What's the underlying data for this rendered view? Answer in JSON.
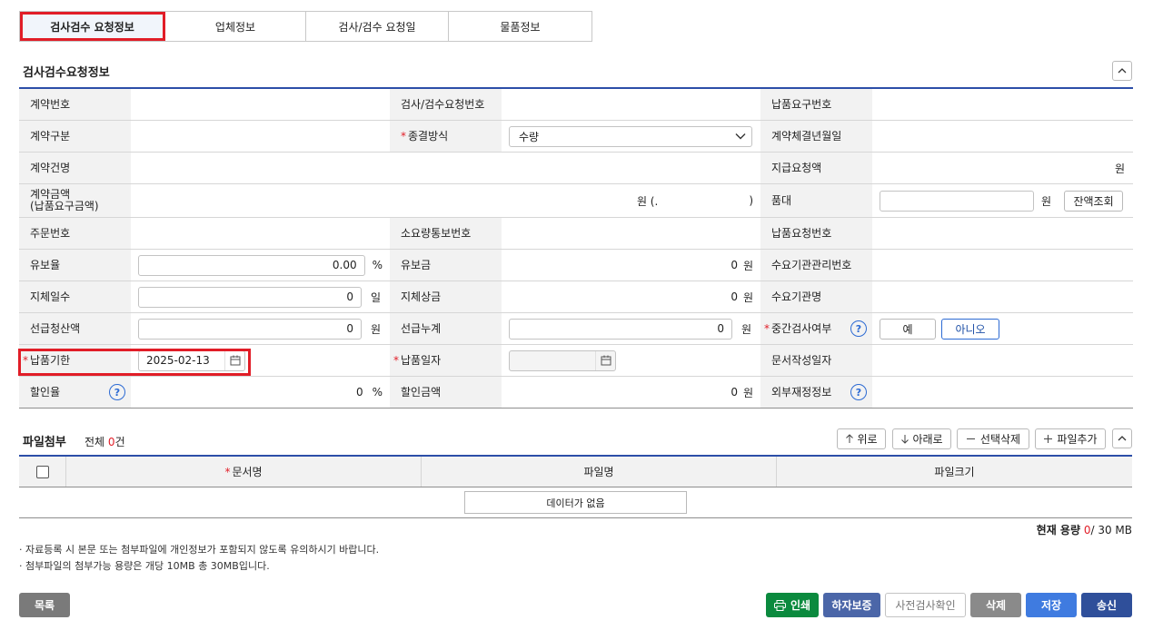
{
  "tabs": [
    "검사검수 요청정보",
    "업체정보",
    "검사/검수 요청일",
    "물품정보"
  ],
  "section_title": "검사검수요청정보",
  "fields": {
    "contract_no": "계약번호",
    "inspect_req_no": "검사/검수요청번호",
    "delivery_req_no": "납품요구번호",
    "contract_type": "계약구분",
    "close_method": "종결방식",
    "close_method_value": "수량",
    "contract_date": "계약체결년월일",
    "contract_name": "계약건명",
    "pay_req_amount": "지급요청액",
    "pay_req_unit": "원",
    "contract_amount_l1": "계약금액",
    "contract_amount_l2": "(납품요구금액)",
    "contract_amount_unit": "원 (.",
    "contract_amount_close": ")",
    "price": "품대",
    "price_unit": "원",
    "balance_btn": "잔액조회",
    "order_no": "주문번호",
    "req_notice_no": "소요량통보번호",
    "delivery_request_no": "납품요청번호",
    "retention_rate": "유보율",
    "retention_rate_value": "0.00",
    "retention_rate_unit": "%",
    "retention_amount": "유보금",
    "retention_amount_value": "0",
    "retention_amount_unit": "원",
    "agency_mgmt_no": "수요기관관리번호",
    "delay_days": "지체일수",
    "delay_days_value": "0",
    "delay_days_unit": "일",
    "delay_penalty": "지체상금",
    "delay_penalty_value": "0",
    "delay_penalty_unit": "원",
    "agency_name": "수요기관명",
    "advance_settle": "선급청산액",
    "advance_settle_value": "0",
    "advance_settle_unit": "원",
    "advance_total": "선급누계",
    "advance_total_value": "0",
    "advance_total_unit": "원",
    "mid_inspect": "중간검사여부",
    "yes": "예",
    "no": "아니오",
    "delivery_deadline": "납품기한",
    "delivery_deadline_value": "2025-02-13",
    "delivery_date": "납품일자",
    "doc_date": "문서작성일자",
    "discount_rate": "할인율",
    "discount_rate_value": "0",
    "discount_rate_unit": "%",
    "discount_amount": "할인금액",
    "discount_amount_value": "0",
    "discount_amount_unit": "원",
    "external_finance": "외부재정정보"
  },
  "attachments": {
    "title": "파일첨부",
    "count_label": "전체",
    "count": "0",
    "count_unit": "건",
    "buttons": {
      "up": "위로",
      "down": "아래로",
      "delete": "선택삭제",
      "add": "파일추가"
    },
    "columns": [
      "문서명",
      "파일명",
      "파일크기"
    ],
    "empty": "데이터가 없음",
    "usage_label": "현재 용량",
    "usage_value": "0",
    "usage_total": "/ 30 MB",
    "notices": [
      "자료등록 시 본문 또는 첨부파일에 개인정보가 포함되지 않도록 유의하시기 바랍니다.",
      "첨부파일의 첨부가능 용량은 개당 10MB 총 30MB입니다."
    ]
  },
  "footer": {
    "list": "목록",
    "print": "인쇄",
    "warranty": "하자보증",
    "precheck": "사전검사확인",
    "delete": "삭제",
    "save": "저장",
    "send": "송신"
  },
  "colors": {
    "accent": "#2c4ea8",
    "highlight": "#e11d27",
    "print_btn": "#0b8a3e",
    "warranty_btn": "#4b66a8",
    "delete_btn": "#8a8a8a",
    "save_btn": "#3f7be0",
    "send_btn": "#2f4f9a"
  },
  "icons": [
    "chevron-up-icon",
    "chevron-down-icon",
    "calendar-icon",
    "help-icon",
    "arrow-up-icon",
    "arrow-down-icon",
    "minus-icon",
    "plus-icon",
    "printer-icon"
  ]
}
